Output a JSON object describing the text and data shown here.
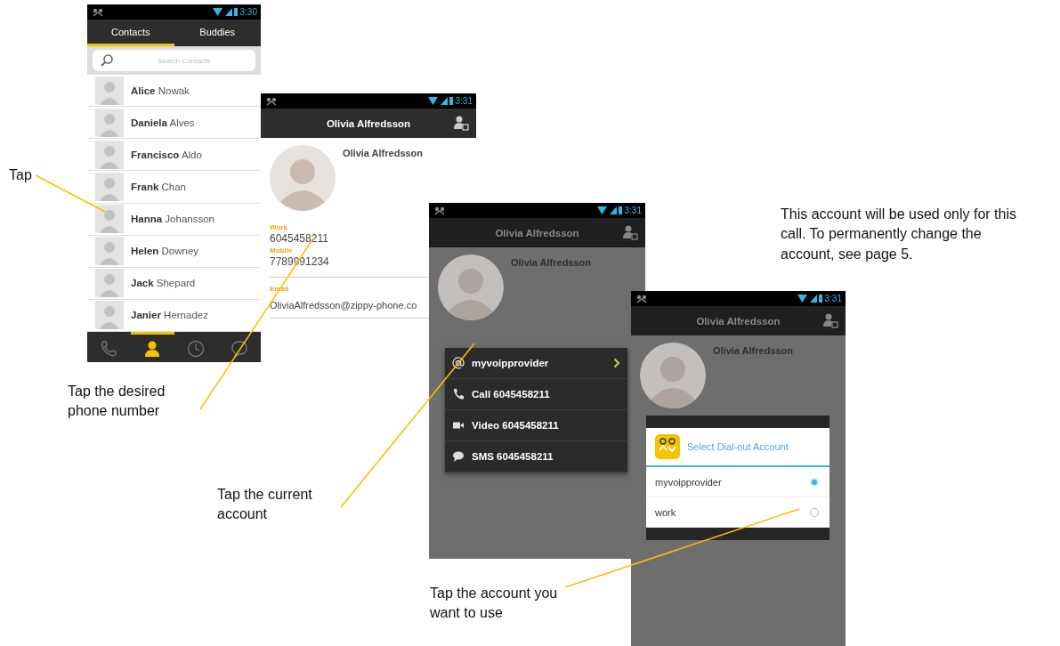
{
  "screens": [
    {
      "kind": "contacts",
      "status_time": "3:30",
      "tabs": [
        {
          "label": "Contacts",
          "selected": true
        },
        {
          "label": "Buddies",
          "selected": false
        }
      ],
      "search": {
        "placeholder": "Search Contacts"
      },
      "contacts": [
        {
          "first": "Alice",
          "last": "Nowak"
        },
        {
          "first": "Daniela",
          "last": "Alves"
        },
        {
          "first": "Francisco",
          "last": "Aldo"
        },
        {
          "first": "Frank",
          "last": "Chan"
        },
        {
          "first": "Hanna",
          "last": "Johansson"
        },
        {
          "first": "Helen",
          "last": "Downey"
        },
        {
          "first": "Jack",
          "last": "Shepard"
        },
        {
          "first": "Janier",
          "last": "Hernadez"
        }
      ],
      "nav": [
        {
          "kind": "phone",
          "selected": false
        },
        {
          "kind": "contacts",
          "selected": true
        },
        {
          "kind": "history",
          "selected": false
        },
        {
          "kind": "chat",
          "selected": false
        }
      ]
    },
    {
      "kind": "details",
      "status_time": "3:31",
      "title": "Olivia Alfredsson",
      "name": "Olivia Alfredsson",
      "fields": [
        {
          "label": "Work",
          "value": "6045458211"
        },
        {
          "label": "Mobile",
          "value": "7789991234"
        },
        {
          "label": "Email",
          "value": "OliviaAlfredsson@zippy-phone.co"
        }
      ]
    },
    {
      "kind": "menu",
      "status_time": "3:31",
      "title": "Olivia Alfredsson",
      "name": "Olivia Alfredsson",
      "menu": [
        {
          "kind": "account",
          "label": "myvoipprovider"
        },
        {
          "kind": "call",
          "label": "Call 6045458211"
        },
        {
          "kind": "video",
          "label": "Video 6045458211"
        },
        {
          "kind": "sms",
          "label": "SMS 6045458211"
        }
      ]
    },
    {
      "kind": "dialog",
      "status_time": "3:31",
      "title": "Olivia Alfredsson",
      "name": "Olivia Alfredsson",
      "dialog": {
        "title": "Select Dial-out Account",
        "options": [
          {
            "label": "myvoipprovider",
            "selected": true
          },
          {
            "label": "work",
            "selected": false
          }
        ]
      }
    }
  ],
  "annotations": [
    {
      "text": "Tap"
    },
    {
      "text": "Tap the desired phone number"
    },
    {
      "text": "Tap the current account"
    },
    {
      "text": "This account will be used only for this call. To permanently change the account, see page 5."
    },
    {
      "text": "Tap the account you want to use"
    }
  ]
}
